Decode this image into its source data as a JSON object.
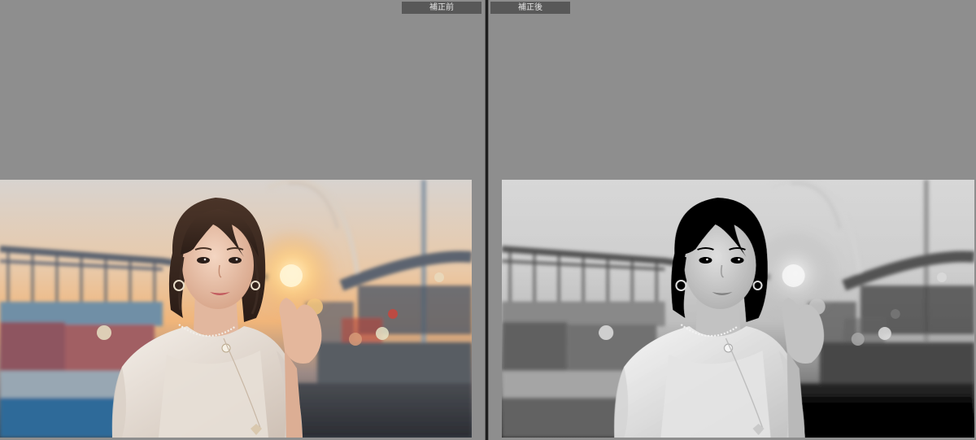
{
  "compare": {
    "before_label": "補正前",
    "after_label": "補正後"
  },
  "colors": {
    "background": "#8d8d8d",
    "label_bg": "#585858",
    "divider": "#1e1e1e",
    "sunset_sky_top": "#d9d3cc",
    "sunset_glow": "#f2b060"
  }
}
